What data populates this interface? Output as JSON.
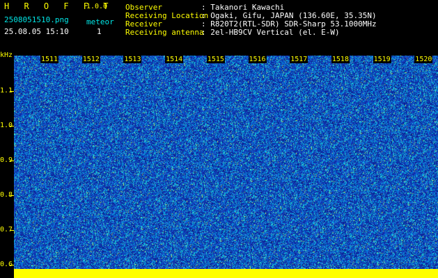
{
  "header": {
    "app_name": "H R O F F T",
    "version": "1.0.0",
    "filename": "2508051510.png",
    "meteor_label": "meteor",
    "datetime": "25.08.05 15:10",
    "meteor_count": "1",
    "observer_label": "Observer",
    "observer_value": ": Takanori Kawachi",
    "location_label": "Receiving Location",
    "location_value": ": Ogaki, Gifu, JAPAN (136.60E, 35.35N)",
    "receiver_label": "Receiver",
    "receiver_value": ": R820T2(RTL-SDR) SDR-Sharp 53.1000MHz",
    "antenna_label": "Receiving antenna",
    "antenna_value": ": 2el-HB9CV Vertical (el. E-W)"
  },
  "axis": {
    "unit": "kHz",
    "y_labels": [
      "1.1",
      "1.0",
      "0.9",
      "0.8",
      "0.7",
      "0.6"
    ],
    "x_labels": [
      "1511",
      "1512",
      "1513",
      "1514",
      "1515",
      "1516",
      "1517",
      "1518",
      "1519",
      "1520"
    ]
  },
  "colors": {
    "background": "#000000",
    "text_cyan": "#00e6e6",
    "text_yellow": "#ffff00",
    "spectrogram_base": "#1b3ea6"
  }
}
